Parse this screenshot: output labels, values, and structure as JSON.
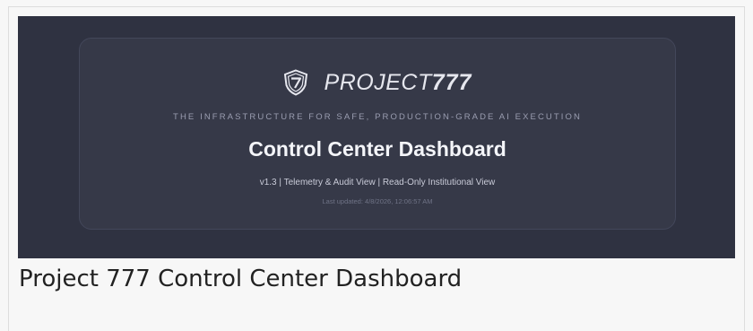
{
  "banner": {
    "brand": {
      "logo_icon": "shield-seven-icon",
      "name_prefix": "PROJECT",
      "name_suffix": "777"
    },
    "tagline": "THE INFRASTRUCTURE FOR SAFE, PRODUCTION-GRADE AI EXECUTION",
    "title": "Control Center Dashboard",
    "subtitle": "v1.3 | Telemetry & Audit View | Read-Only Institutional View",
    "last_updated": "Last updated: 4/8/2026, 12:06:57 AM"
  },
  "caption": "Project 777 Control Center Dashboard",
  "colors": {
    "banner_bg": "#2f3241",
    "card_bg": "#363948",
    "accent_text": "#f4f5f9"
  }
}
